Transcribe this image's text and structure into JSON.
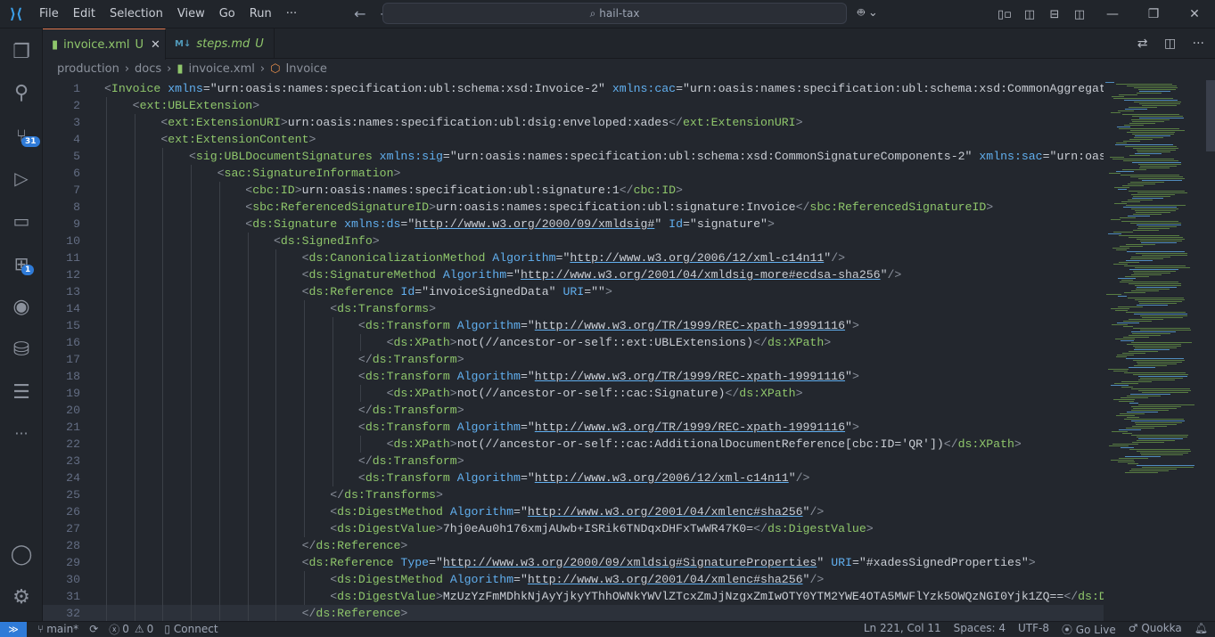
{
  "menu": [
    "File",
    "Edit",
    "Selection",
    "View",
    "Go",
    "Run",
    "···"
  ],
  "search": {
    "text": "hail-tax",
    "icon": "search-icon"
  },
  "tabs": [
    {
      "label": "invoice.xml",
      "status": "U",
      "icon": "xml-file-icon"
    },
    {
      "label": "steps.md",
      "status": "U",
      "icon": "markdown-icon",
      "prefix": "M↓"
    }
  ],
  "breadcrumb": [
    "production",
    "docs",
    "invoice.xml",
    "Invoice"
  ],
  "activity": {
    "source_control_badge": "31",
    "extensions_badge": "1"
  },
  "editor": {
    "current_line": 32,
    "lines": [
      "<Invoice xmlns=\"urn:oasis:names:specification:ubl:schema:xsd:Invoice-2\" xmlns:cac=\"urn:oasis:names:specification:ubl:schema:xsd:CommonAggregateCo",
      "    <ext:UBLExtension>",
      "        <ext:ExtensionURI>urn:oasis:names:specification:ubl:dsig:enveloped:xades</ext:ExtensionURI>",
      "        <ext:ExtensionContent>",
      "            <sig:UBLDocumentSignatures xmlns:sig=\"urn:oasis:names:specification:ubl:schema:xsd:CommonSignatureComponents-2\" xmlns:sac=\"urn:oasis:",
      "                <sac:SignatureInformation>",
      "                    <cbc:ID>urn:oasis:names:specification:ubl:signature:1</cbc:ID>",
      "                    <sbc:ReferencedSignatureID>urn:oasis:names:specification:ubl:signature:Invoice</sbc:ReferencedSignatureID>",
      "                    <ds:Signature xmlns:ds=\"http://www.w3.org/2000/09/xmldsig#\" Id=\"signature\">",
      "                        <ds:SignedInfo>",
      "                            <ds:CanonicalizationMethod Algorithm=\"http://www.w3.org/2006/12/xml-c14n11\"/>",
      "                            <ds:SignatureMethod Algorithm=\"http://www.w3.org/2001/04/xmldsig-more#ecdsa-sha256\"/>",
      "                            <ds:Reference Id=\"invoiceSignedData\" URI=\"\">",
      "                                <ds:Transforms>",
      "                                    <ds:Transform Algorithm=\"http://www.w3.org/TR/1999/REC-xpath-19991116\">",
      "                                        <ds:XPath>not(//ancestor-or-self::ext:UBLExtensions)</ds:XPath>",
      "                                    </ds:Transform>",
      "                                    <ds:Transform Algorithm=\"http://www.w3.org/TR/1999/REC-xpath-19991116\">",
      "                                        <ds:XPath>not(//ancestor-or-self::cac:Signature)</ds:XPath>",
      "                                    </ds:Transform>",
      "                                    <ds:Transform Algorithm=\"http://www.w3.org/TR/1999/REC-xpath-19991116\">",
      "                                        <ds:XPath>not(//ancestor-or-self::cac:AdditionalDocumentReference[cbc:ID='QR'])</ds:XPath>",
      "                                    </ds:Transform>",
      "                                    <ds:Transform Algorithm=\"http://www.w3.org/2006/12/xml-c14n11\"/>",
      "                                </ds:Transforms>",
      "                                <ds:DigestMethod Algorithm=\"http://www.w3.org/2001/04/xmlenc#sha256\"/>",
      "                                <ds:DigestValue>7hj0eAu0h176xmjAUwb+ISRik6TNDqxDHFxTwWR47K0=</ds:DigestValue>",
      "                            </ds:Reference>",
      "                            <ds:Reference Type=\"http://www.w3.org/2000/09/xmldsig#SignatureProperties\" URI=\"#xadesSignedProperties\">",
      "                                <ds:DigestMethod Algorithm=\"http://www.w3.org/2001/04/xmlenc#sha256\"/>",
      "                                <ds:DigestValue>MzUzYzFmMDhkNjAyYjkyYThhOWNkYWVlZTcxZmJjNzgxZmIwOTY0YTM2YWE4OTA5MWFlYzk5OWQzNGI0Yjk1ZQ==</ds:Dige",
      "                            </ds:Reference>"
    ]
  },
  "status": {
    "branch": "main*",
    "errors": "0",
    "warnings": "0",
    "connect": "Connect",
    "position": "Ln 221, Col 11",
    "spaces": "Spaces: 4",
    "encoding": "UTF-8",
    "golive": "Go Live",
    "quokka": "Quokka"
  },
  "colors": {
    "tag": "#8fc66b",
    "attribute": "#61afef",
    "accent": "#2f7bd8",
    "active_tab_border": "#e07b53"
  }
}
